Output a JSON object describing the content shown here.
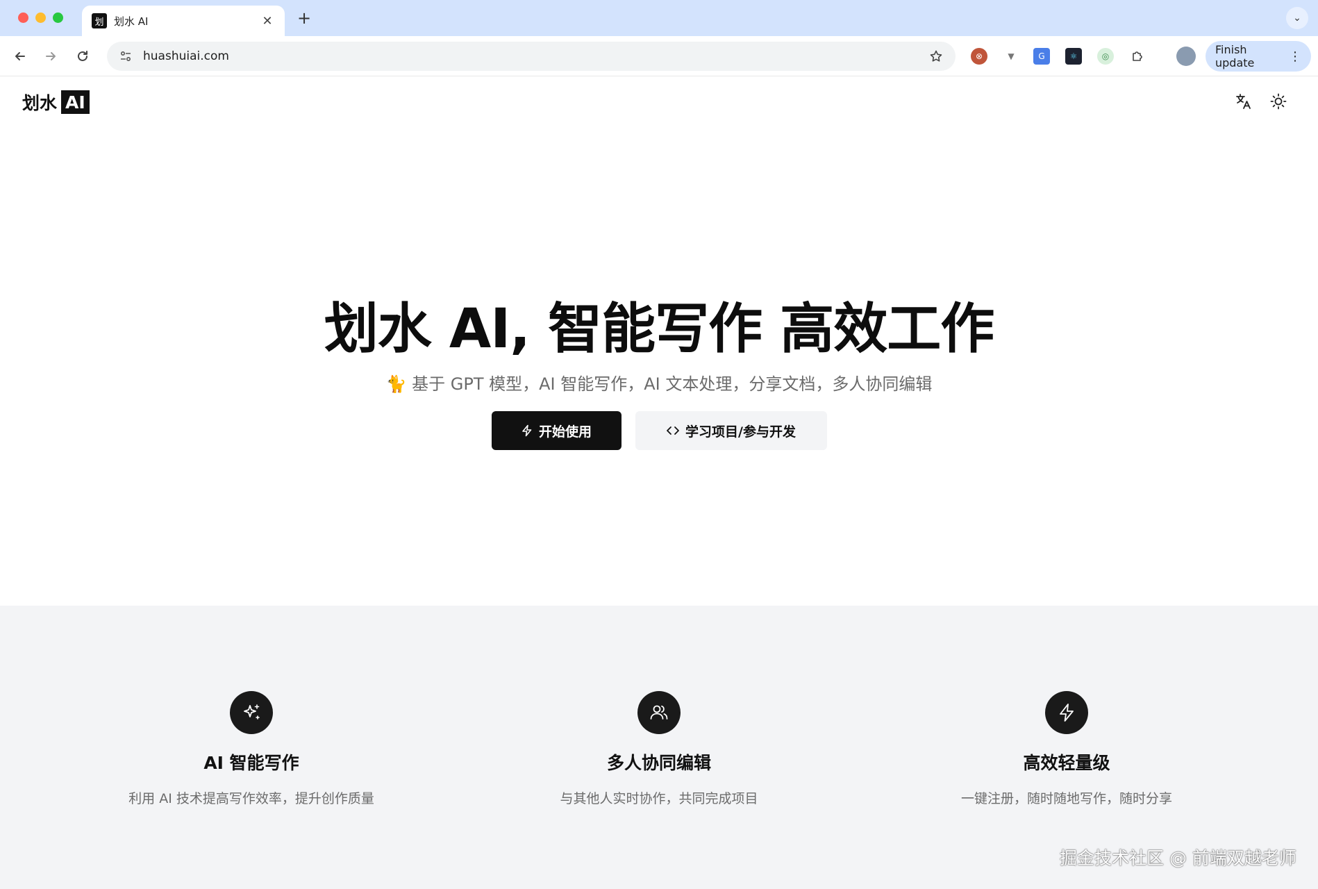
{
  "browser": {
    "tab_title": "划水 AI",
    "tab_favicon": "划",
    "url": "huashuiai.com",
    "finish_update_label": "Finish update"
  },
  "header": {
    "logo_text": "划水",
    "logo_badge": "AI"
  },
  "hero": {
    "title": "划水 AI, 智能写作 高效工作",
    "subtitle": "🐈 基于 GPT 模型，AI 智能写作，AI 文本处理，分享文档，多人协同编辑",
    "primary_button": "开始使用",
    "secondary_button": "学习项目/参与开发"
  },
  "features": [
    {
      "icon": "sparkles-icon",
      "title": "AI 智能写作",
      "desc": "利用 AI 技术提高写作效率，提升创作质量"
    },
    {
      "icon": "users-icon",
      "title": "多人协同编辑",
      "desc": "与其他人实时协作，共同完成项目"
    },
    {
      "icon": "zap-icon",
      "title": "高效轻量级",
      "desc": "一键注册，随时随地写作，随时分享"
    }
  ],
  "watermark": "掘金技术社区 @ 前端双越老师"
}
